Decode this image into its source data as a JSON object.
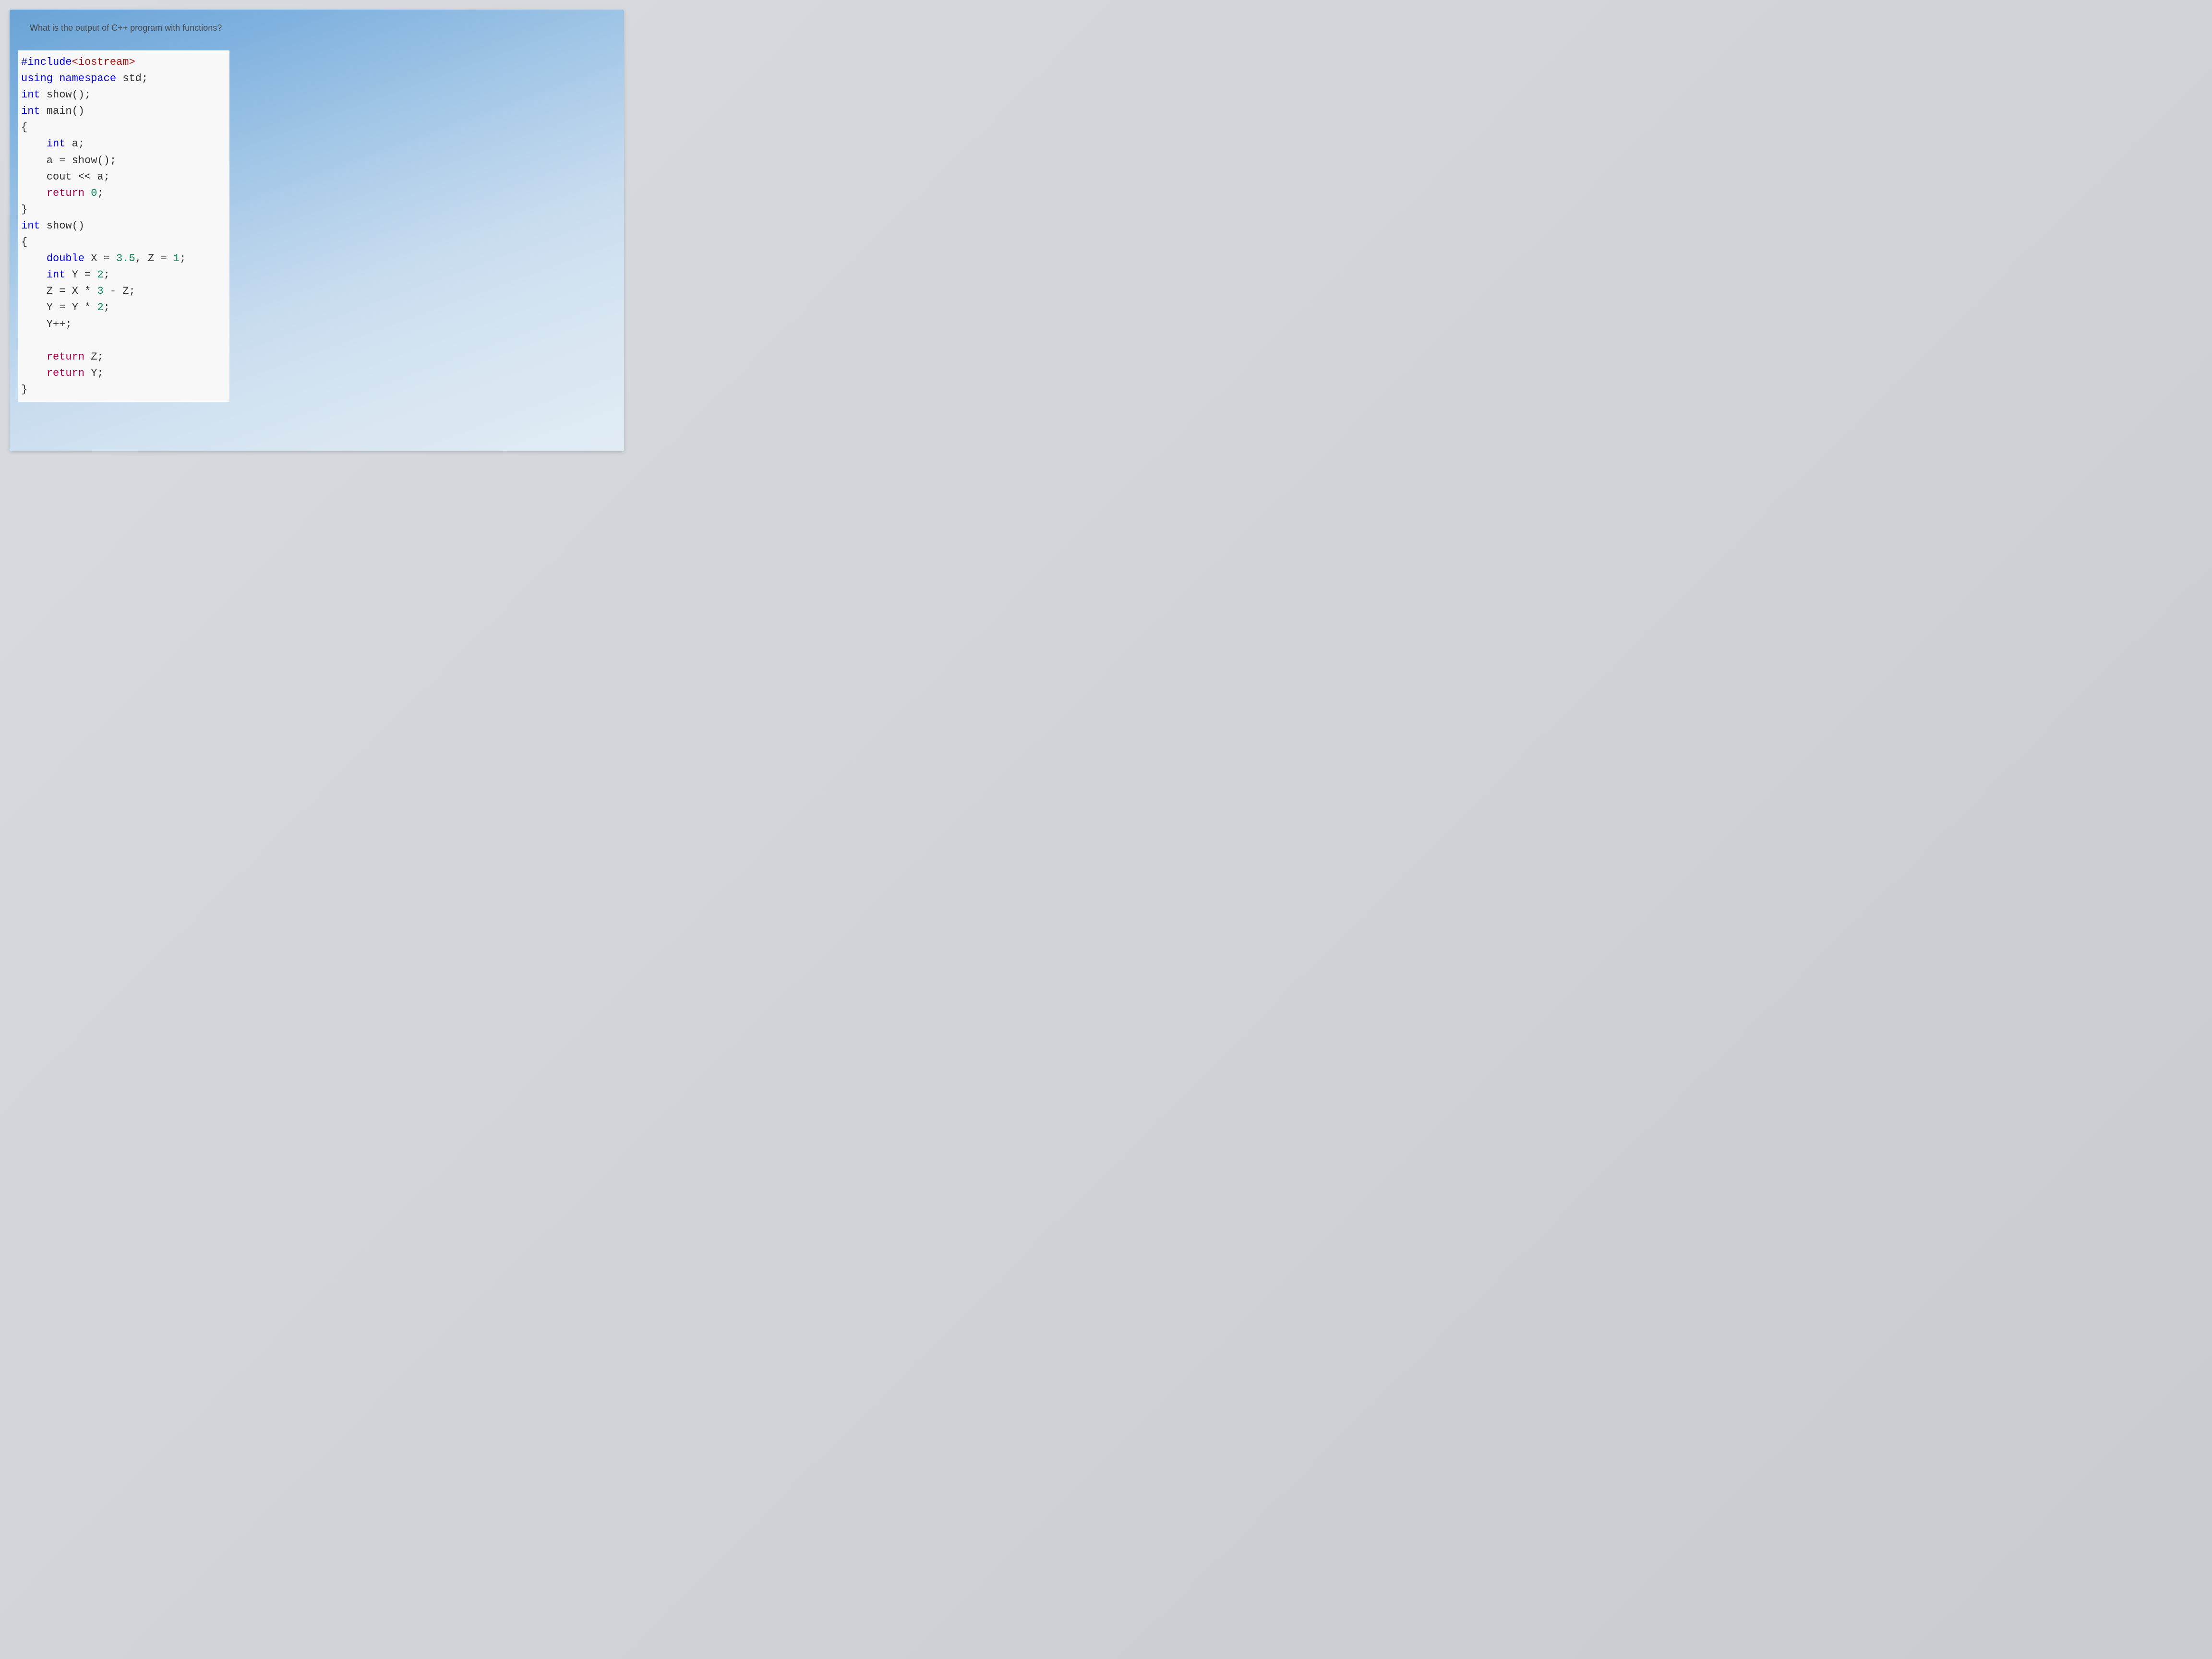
{
  "question": "What is the output of C++ program with functions?",
  "code": {
    "lines": [
      {
        "segments": [
          {
            "t": "#include",
            "c": "kw-preproc"
          },
          {
            "t": "<iostream>",
            "c": "str-literal"
          }
        ]
      },
      {
        "segments": [
          {
            "t": "using",
            "c": "kw-keyword"
          },
          {
            "t": " ",
            "c": ""
          },
          {
            "t": "namespace",
            "c": "kw-keyword"
          },
          {
            "t": " std;",
            "c": "identifier"
          }
        ]
      },
      {
        "segments": [
          {
            "t": "int",
            "c": "kw-type"
          },
          {
            "t": " show();",
            "c": "identifier"
          }
        ]
      },
      {
        "segments": [
          {
            "t": "int",
            "c": "kw-type"
          },
          {
            "t": " main()",
            "c": "identifier"
          }
        ]
      },
      {
        "segments": [
          {
            "t": "{",
            "c": "identifier"
          }
        ]
      },
      {
        "segments": [
          {
            "t": "    ",
            "c": ""
          },
          {
            "t": "int",
            "c": "kw-type"
          },
          {
            "t": " a;",
            "c": "identifier"
          }
        ]
      },
      {
        "segments": [
          {
            "t": "    a = show();",
            "c": "identifier"
          }
        ]
      },
      {
        "segments": [
          {
            "t": "    cout << a;",
            "c": "identifier"
          }
        ]
      },
      {
        "segments": [
          {
            "t": "    ",
            "c": ""
          },
          {
            "t": "return",
            "c": "kw-flow"
          },
          {
            "t": " ",
            "c": ""
          },
          {
            "t": "0",
            "c": "num-literal"
          },
          {
            "t": ";",
            "c": "identifier"
          }
        ]
      },
      {
        "segments": [
          {
            "t": "}",
            "c": "identifier"
          }
        ]
      },
      {
        "segments": [
          {
            "t": "int",
            "c": "kw-type"
          },
          {
            "t": " show()",
            "c": "identifier"
          }
        ]
      },
      {
        "segments": [
          {
            "t": "{",
            "c": "identifier"
          }
        ]
      },
      {
        "segments": [
          {
            "t": "    ",
            "c": ""
          },
          {
            "t": "double",
            "c": "kw-type"
          },
          {
            "t": " X = ",
            "c": "identifier"
          },
          {
            "t": "3.5",
            "c": "num-literal"
          },
          {
            "t": ", Z = ",
            "c": "identifier"
          },
          {
            "t": "1",
            "c": "num-literal"
          },
          {
            "t": ";",
            "c": "identifier"
          }
        ]
      },
      {
        "segments": [
          {
            "t": "    ",
            "c": ""
          },
          {
            "t": "int",
            "c": "kw-type"
          },
          {
            "t": " Y = ",
            "c": "identifier"
          },
          {
            "t": "2",
            "c": "num-literal"
          },
          {
            "t": ";",
            "c": "identifier"
          }
        ]
      },
      {
        "segments": [
          {
            "t": "    Z = X * ",
            "c": "identifier"
          },
          {
            "t": "3",
            "c": "num-literal"
          },
          {
            "t": " - Z;",
            "c": "identifier"
          }
        ]
      },
      {
        "segments": [
          {
            "t": "    Y = Y * ",
            "c": "identifier"
          },
          {
            "t": "2",
            "c": "num-literal"
          },
          {
            "t": ";",
            "c": "identifier"
          }
        ]
      },
      {
        "segments": [
          {
            "t": "    Y++;",
            "c": "identifier"
          }
        ]
      },
      {
        "segments": [
          {
            "t": " ",
            "c": ""
          }
        ]
      },
      {
        "segments": [
          {
            "t": "    ",
            "c": ""
          },
          {
            "t": "return",
            "c": "kw-flow"
          },
          {
            "t": " Z;",
            "c": "identifier"
          }
        ]
      },
      {
        "segments": [
          {
            "t": "    ",
            "c": ""
          },
          {
            "t": "return",
            "c": "kw-flow"
          },
          {
            "t": " Y;",
            "c": "identifier"
          }
        ]
      },
      {
        "segments": [
          {
            "t": "}",
            "c": "identifier"
          }
        ]
      }
    ]
  }
}
